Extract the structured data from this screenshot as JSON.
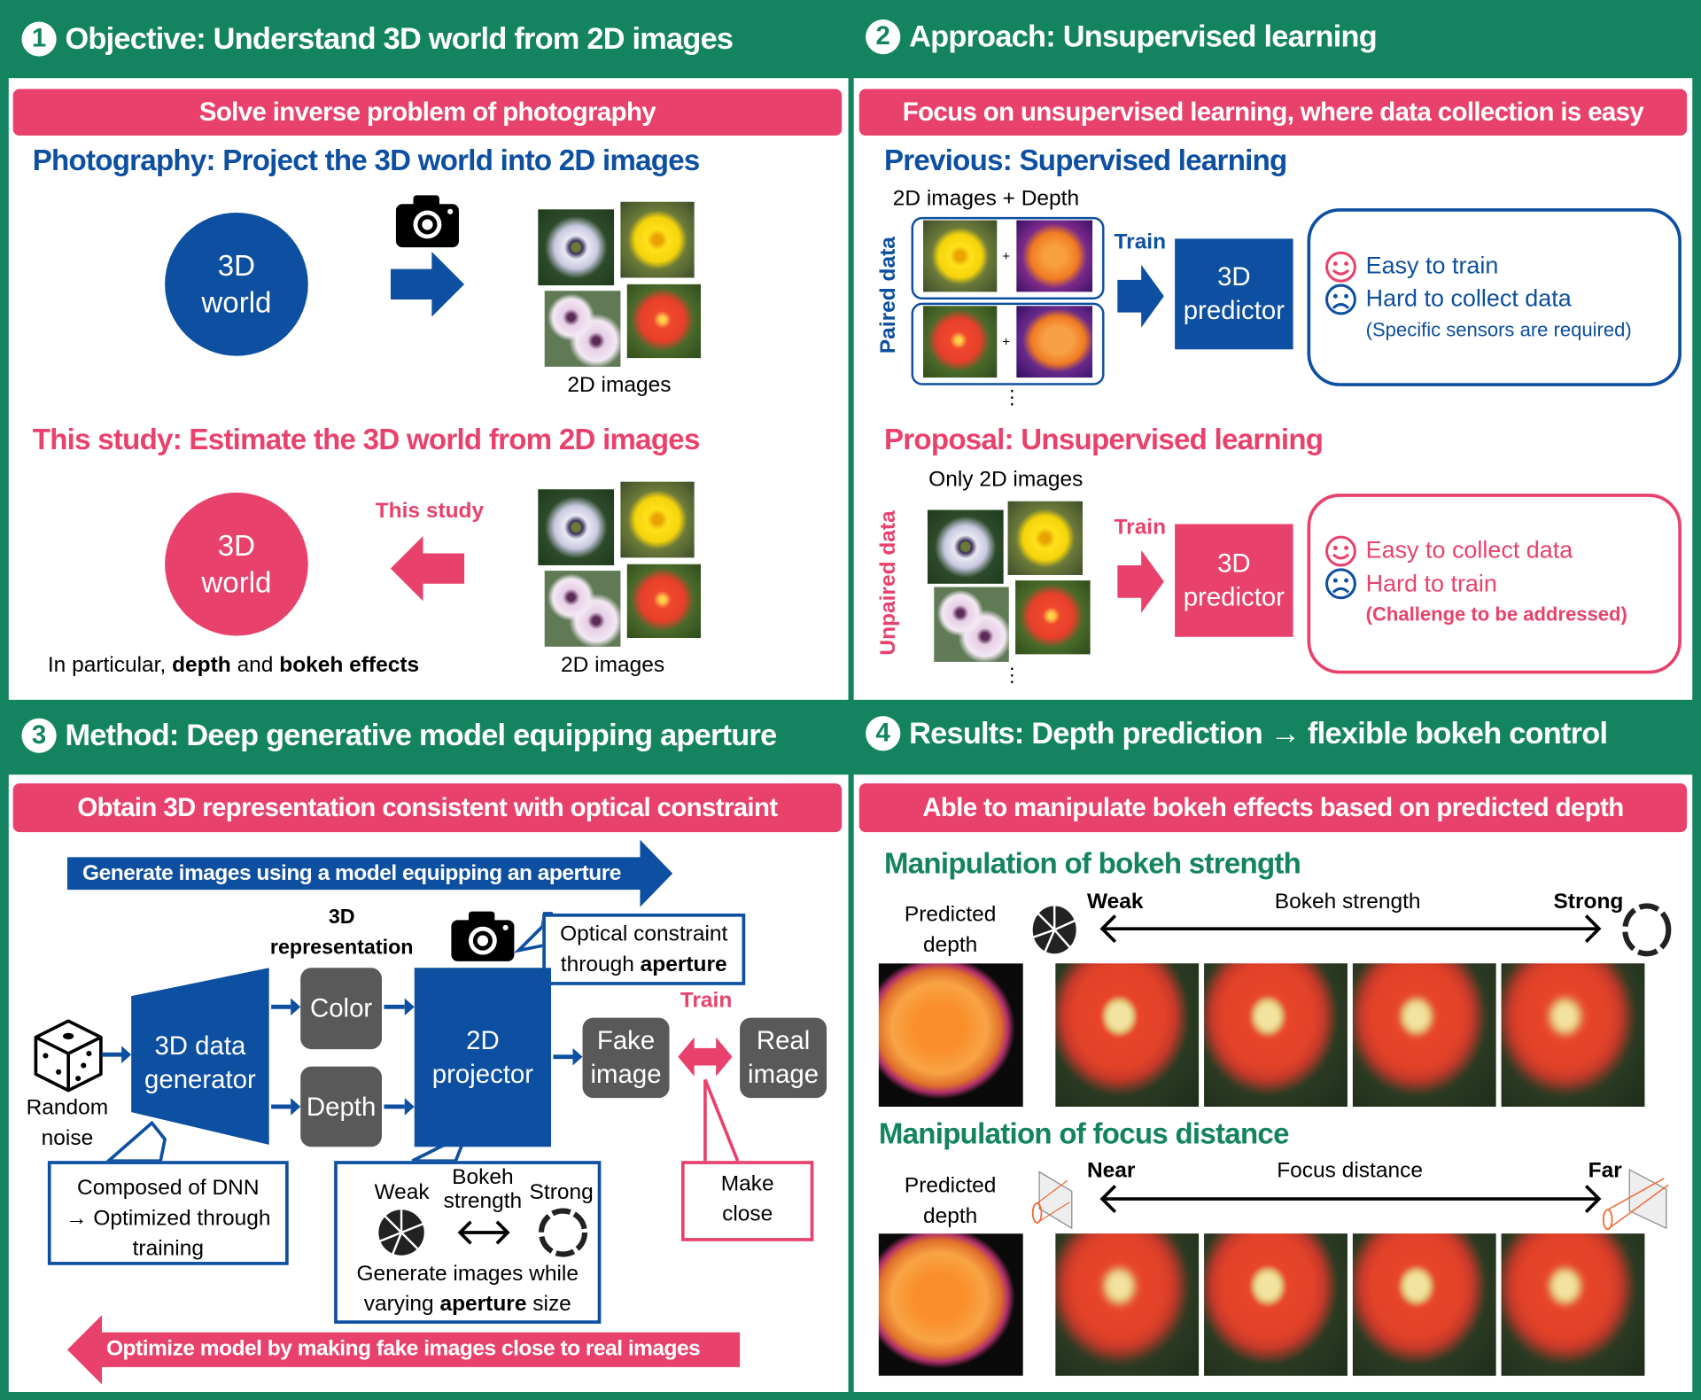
{
  "colors": {
    "green": "#13845f",
    "pink": "#e8426c",
    "blue": "#0d4fa0",
    "gray": "#595959"
  },
  "section1": {
    "number": "1",
    "title": "Objective: Understand 3D world from 2D images",
    "banner": "Solve inverse problem of photography",
    "photography_heading": "Photography: Project the 3D world into 2D images",
    "world_circle": "3D world",
    "images_label": "2D images",
    "study_heading": "This study: Estimate the 3D world from 2D images",
    "study_arrow_label": "This study",
    "world_circle2": "3D world",
    "images_label2": "2D images",
    "note": {
      "p1": "In particular, ",
      "b1": "depth",
      "p2": " and ",
      "b2": "bokeh effects"
    },
    "icons": [
      "camera-icon",
      "arrow-right-icon",
      "arrow-left-icon"
    ]
  },
  "section2": {
    "number": "2",
    "title": "Approach: Unsupervised learning",
    "banner": "Focus on unsupervised learning, where data collection is easy",
    "previous_heading": "Previous: Supervised learning",
    "paired_caption": "2D images + Depth",
    "paired_label": "Paired data",
    "plus": "+",
    "ellipsis": "⋮",
    "train": "Train",
    "predictor": "3D predictor",
    "prev_pros": "Easy to train",
    "prev_cons": "Hard to collect data",
    "prev_note": "(Specific sensors are required)",
    "proposal_heading": "Proposal: Unsupervised learning",
    "unpaired_caption": "Only 2D images",
    "unpaired_label": "Unpaired data",
    "train2": "Train",
    "predictor2": "3D predictor",
    "prop_pros": "Easy to collect data",
    "prop_cons": "Hard to train",
    "prop_note": "(Challenge to be addressed)",
    "icons": [
      "smile-icon",
      "frown-icon"
    ]
  },
  "section3": {
    "number": "3",
    "title": "Method: Deep generative model equipping aperture",
    "banner": "Obtain 3D representation consistent with optical constraint",
    "generate_arrow": "Generate images using a model equipping an aperture",
    "rep_label": "3D representation",
    "optical_line1": "Optical constraint",
    "optical_line2a": "through ",
    "optical_line2b": "aperture",
    "random_noise": "Random noise",
    "generator": "3D data generator",
    "color": "Color",
    "depth": "Depth",
    "projector": "2D projector",
    "fake": "Fake image",
    "real": "Real image",
    "train": "Train",
    "dnn_line1": "Composed of DNN",
    "dnn_line2": "→ Optimized through training",
    "weak": "Weak",
    "bokeh_strength": "Bokeh strength",
    "strong": "Strong",
    "gen_line1": "Generate images while",
    "gen_line2a": "varying ",
    "gen_line2b": "aperture",
    "gen_line2c": " size",
    "make_close": "Make close",
    "optimize_arrow": "Optimize model by making fake images close to real images",
    "icons": [
      "dice-icon",
      "camera-icon",
      "aperture-small-icon",
      "aperture-large-icon",
      "double-arrow-icon"
    ]
  },
  "section4": {
    "number": "4",
    "title": "Results: Depth prediction → flexible bokeh control",
    "banner": "Able to manipulate bokeh effects based on predicted depth",
    "bokeh_heading": "Manipulation of bokeh strength",
    "predicted_depth": "Predicted depth",
    "weak": "Weak",
    "bokeh_strength": "Bokeh strength",
    "strong": "Strong",
    "focus_heading": "Manipulation of focus distance",
    "predicted_depth2": "Predicted depth",
    "near": "Near",
    "focus_distance": "Focus distance",
    "far": "Far",
    "bokeh_levels": [
      1,
      2,
      3,
      4
    ],
    "focus_levels": [
      1,
      2,
      3,
      4
    ],
    "icons": [
      "aperture-small-icon",
      "aperture-large-icon",
      "lens-near-icon",
      "lens-far-icon"
    ]
  }
}
